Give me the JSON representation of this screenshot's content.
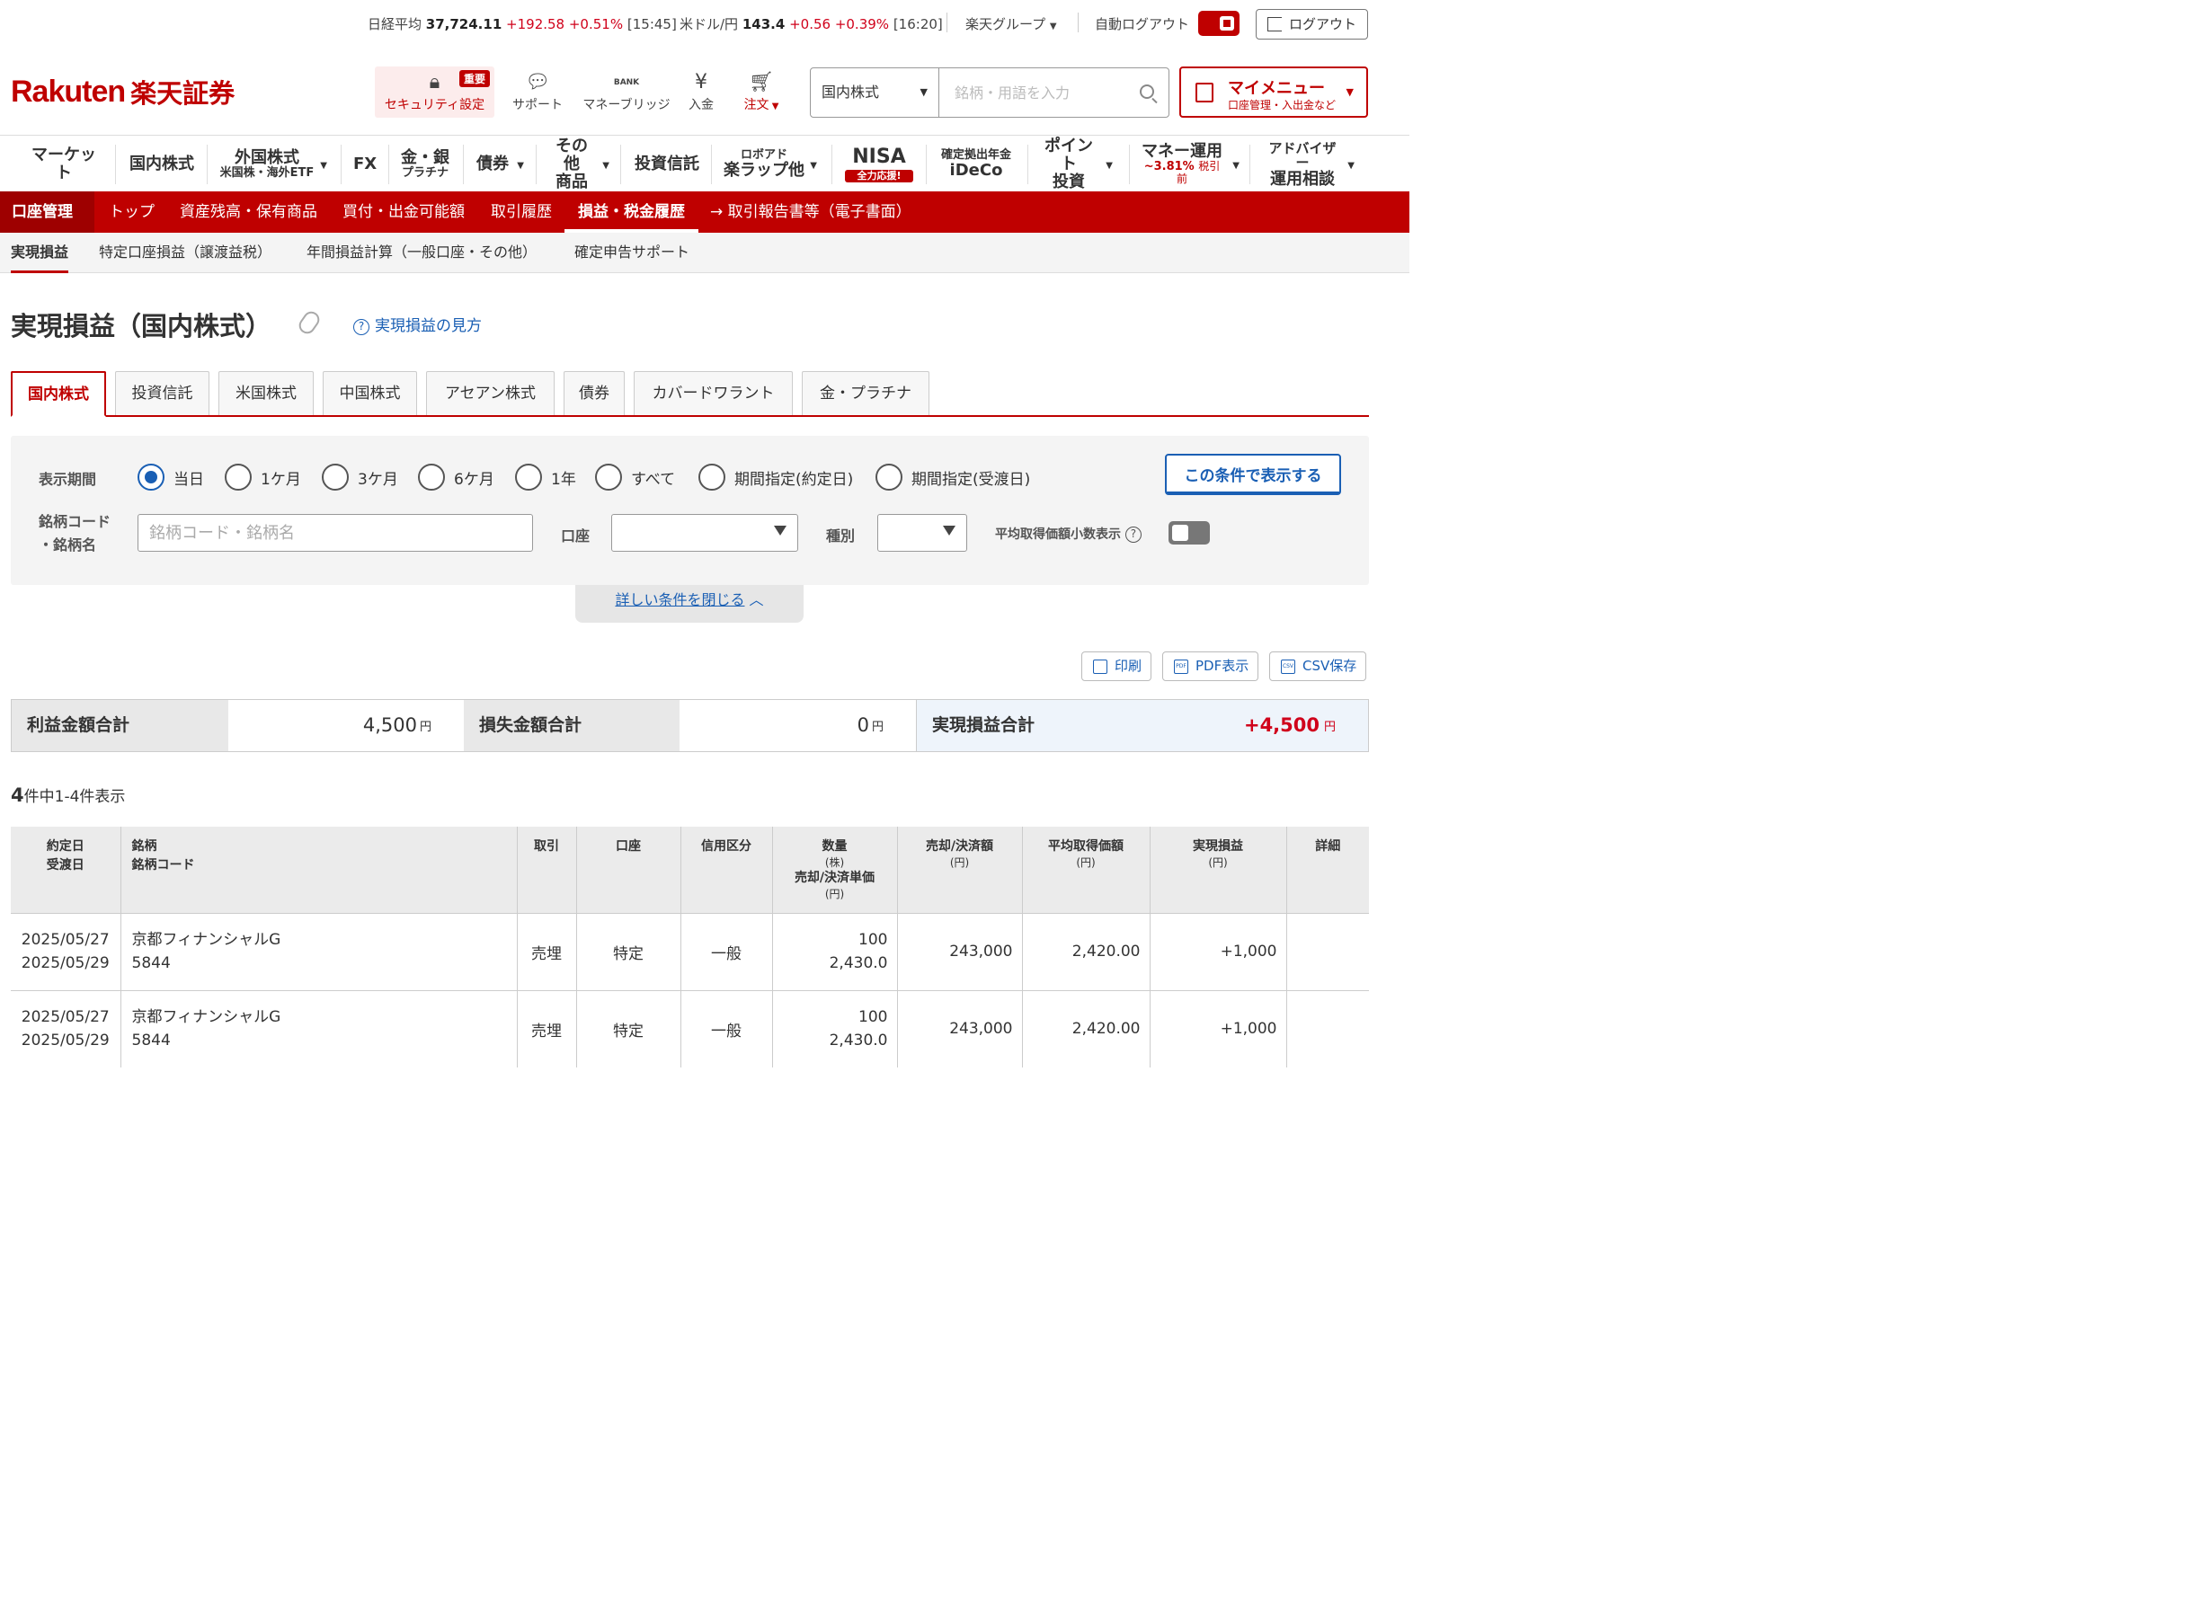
{
  "topbar": {
    "nikkei_label": "日経平均",
    "nikkei_value": "37,724.11",
    "nikkei_change": "+192.58 +0.51%",
    "nikkei_time": "[15:45]",
    "usd_label": "米ドル/円",
    "usd_value": "143.4",
    "usd_change": "+0.56 +0.39%",
    "usd_time": "[16:20]",
    "group": "楽天グループ",
    "auto_logout": "自動ログアウト",
    "logout": "ログアウト"
  },
  "header": {
    "logo_en": "Rakuten",
    "logo_jp": "楽天証券",
    "icons": [
      {
        "label": "セキュリティ設定",
        "icon": "lock-icon",
        "badge": "重要"
      },
      {
        "label": "サポート",
        "icon": "support-icon"
      },
      {
        "label": "マネーブリッジ",
        "icon": "bank-icon",
        "glyph": "BANK"
      },
      {
        "label": "入金",
        "icon": "yen-deposit-icon"
      },
      {
        "label": "注文",
        "icon": "cart-icon"
      }
    ],
    "search_category": "国内株式",
    "search_placeholder": "銘柄・用語を入力",
    "mymenu_title": "マイメニュー",
    "mymenu_sub": "口座管理・入出金など"
  },
  "gnav": [
    {
      "label": "マーケット"
    },
    {
      "label": "国内株式"
    },
    {
      "label": "外国株式",
      "sub": "米国株・海外ETF"
    },
    {
      "label": "FX"
    },
    {
      "label": "金・銀",
      "sub": "プラチナ"
    },
    {
      "label": "債券"
    },
    {
      "label": "その他",
      "sub": "商品"
    },
    {
      "label": "投資信託"
    },
    {
      "label": "ロボアド",
      "sub": "楽ラップ他"
    },
    {
      "label": "NISA",
      "sub": "全力応援!"
    },
    {
      "label": "確定拠出年金",
      "sub": "iDeCo"
    },
    {
      "label": "ポイント",
      "sub": "投資"
    },
    {
      "label": "マネー運用",
      "sub": "~3.81%",
      "sub2": "税引前"
    },
    {
      "label": "アドバイザー",
      "sub": "運用相談"
    }
  ],
  "account_nav": {
    "title": "口座管理",
    "items": [
      "トップ",
      "資産残高・保有商品",
      "買付・出金可能額",
      "取引履歴",
      "損益・税金履歴",
      "→ 取引報告書等（電子書面）"
    ]
  },
  "sub_nav": [
    "実現損益",
    "特定口座損益（譲渡益税）",
    "年間損益計算（一般口座・その他）",
    "確定申告サポート"
  ],
  "page": {
    "title": "実現損益（国内株式）",
    "help": "実現損益の見方"
  },
  "tabs": [
    "国内株式",
    "投資信託",
    "米国株式",
    "中国株式",
    "アセアン株式",
    "債券",
    "カバードワラント",
    "金・プラチナ"
  ],
  "filter": {
    "period_label": "表示期間",
    "periods": [
      "当日",
      "1ケ月",
      "3ケ月",
      "6ケ月",
      "1年",
      "すべて",
      "期間指定(約定日)",
      "期間指定(受渡日)"
    ],
    "apply": "この条件で表示する",
    "code_label_1": "銘柄コード",
    "code_label_2": "・銘柄名",
    "code_placeholder": "銘柄コード・銘柄名",
    "account_label": "口座",
    "type_label": "種別",
    "avg_label": "平均取得価額小数表示",
    "close": "詳しい条件を閉じる"
  },
  "output": {
    "print": "印刷",
    "pdf": "PDF表示",
    "csv": "CSV保存",
    "pdf_glyph": "PDF",
    "csv_glyph": "CSV"
  },
  "summary": {
    "profit_label": "利益金額合計",
    "profit_value": "4,500",
    "loss_label": "損失金額合計",
    "loss_value": "0",
    "total_label": "実現損益合計",
    "total_value": "+4,500",
    "unit": "円"
  },
  "count": {
    "total": "4",
    "text": "件中1-4件表示"
  },
  "table": {
    "headers": {
      "date1": "約定日",
      "date2": "受渡日",
      "name1": "銘柄",
      "name2": "銘柄コード",
      "trade": "取引",
      "account": "口座",
      "credit": "信用区分",
      "qty": "数量",
      "qty_unit": "(株)",
      "price": "売却/決済単価",
      "price_unit": "(円)",
      "amount": "売却/決済額",
      "amount_unit": "(円)",
      "avg": "平均取得価額",
      "avg_unit": "(円)",
      "pl": "実現損益",
      "pl_unit": "(円)",
      "detail": "詳細"
    },
    "rows": [
      {
        "trade_date": "2025/05/27",
        "settle_date": "2025/05/29",
        "name": "京都フィナンシャルG",
        "code": "5844",
        "trade": "売埋",
        "account": "特定",
        "credit": "一般",
        "qty": "100",
        "price": "2,430.0",
        "amount": "243,000",
        "avg": "2,420.00",
        "pl": "+1,000"
      },
      {
        "trade_date": "2025/05/27",
        "settle_date": "2025/05/29",
        "name": "京都フィナンシャルG",
        "code": "5844",
        "trade": "売埋",
        "account": "特定",
        "credit": "一般",
        "qty": "100",
        "price": "2,430.0",
        "amount": "243,000",
        "avg": "2,420.00",
        "pl": "+1,000"
      }
    ]
  },
  "colors": {
    "brand": "#bf0000",
    "link": "#1a5fb4",
    "profit": "#d0021b"
  }
}
